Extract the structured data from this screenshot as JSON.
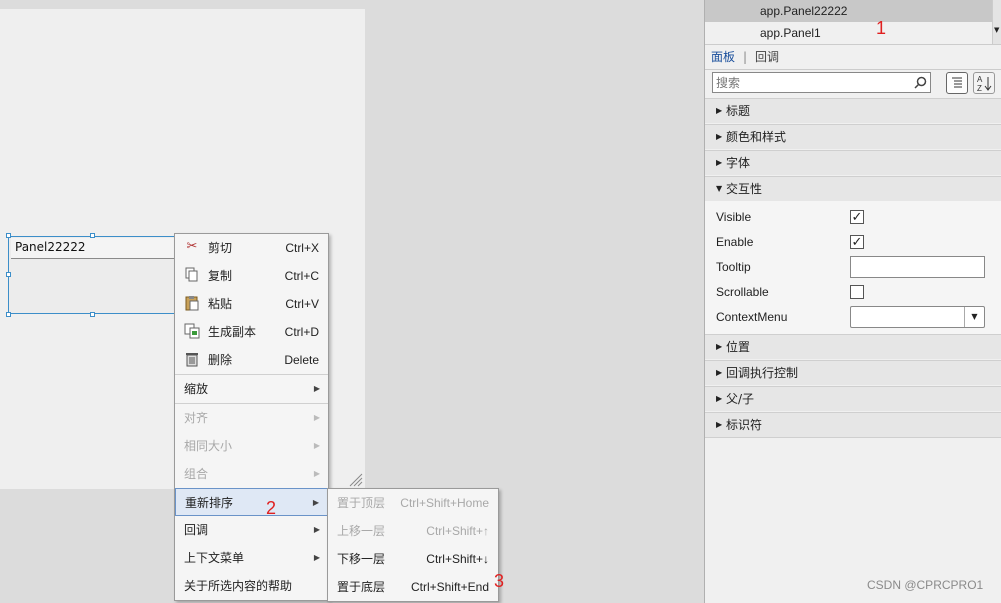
{
  "canvas": {
    "panel_title": "Panel22222"
  },
  "context_menu": {
    "items": [
      {
        "label": "剪切",
        "shortcut": "Ctrl+X",
        "icon": "scissors-icon"
      },
      {
        "label": "复制",
        "shortcut": "Ctrl+C",
        "icon": "copy-icon"
      },
      {
        "label": "粘贴",
        "shortcut": "Ctrl+V",
        "icon": "paste-icon"
      },
      {
        "label": "生成副本",
        "shortcut": "Ctrl+D",
        "icon": "duplicate-icon"
      },
      {
        "label": "删除",
        "shortcut": "Delete",
        "icon": "trash-icon"
      },
      {
        "label": "缩放"
      },
      {
        "label": "对齐"
      },
      {
        "label": "相同大小"
      },
      {
        "label": "组合"
      },
      {
        "label": "重新排序"
      },
      {
        "label": "回调"
      },
      {
        "label": "上下文菜单"
      },
      {
        "label": "关于所选内容的帮助"
      }
    ]
  },
  "submenu": {
    "items": [
      {
        "label": "置于顶层",
        "shortcut": "Ctrl+Shift+Home"
      },
      {
        "label": "上移一层",
        "shortcut": "Ctrl+Shift+↑"
      },
      {
        "label": "下移一层",
        "shortcut": "Ctrl+Shift+↓"
      },
      {
        "label": "置于底层",
        "shortcut": "Ctrl+Shift+End"
      }
    ]
  },
  "inspector": {
    "tree": [
      "app.Panel22222",
      "app.Panel1"
    ],
    "tabs": {
      "panel": "面板",
      "sep": "|",
      "callback": "回调"
    },
    "search_placeholder": "搜索",
    "sections_top": [
      "标题",
      "颜色和样式",
      "字体"
    ],
    "interactivity": "交互性",
    "props": {
      "visible": "Visible",
      "enable": "Enable",
      "tooltip": "Tooltip",
      "scrollable": "Scrollable",
      "contextmenu": "ContextMenu"
    },
    "sections_bottom": [
      "位置",
      "回调执行控制",
      "父/子",
      "标识符"
    ]
  },
  "annotations": [
    "1",
    "2",
    "3"
  ],
  "watermark": "CSDN @CPRCPRO1",
  "colors": {
    "selection_border": "#3c8ec9",
    "annotation": "#e02020",
    "tab_active": "#1a4f9c"
  }
}
